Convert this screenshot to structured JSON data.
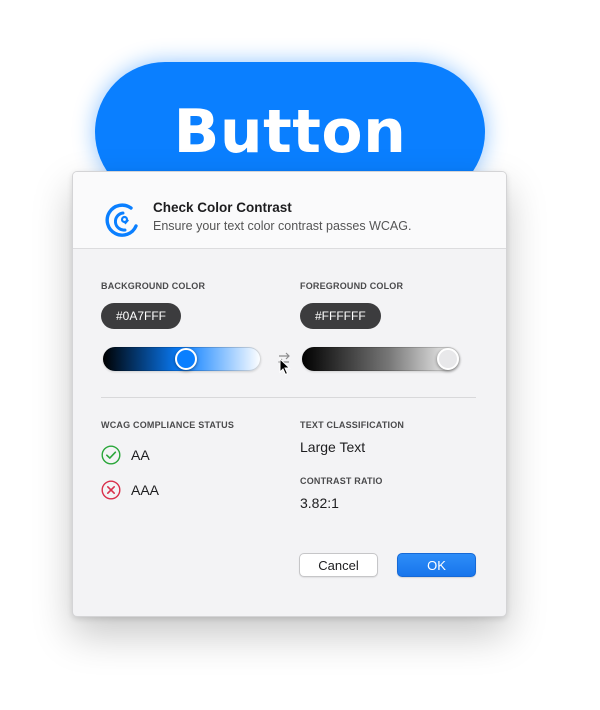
{
  "preview": {
    "label": "Button",
    "background": "#0A7FFF",
    "text_color": "#FFFFFF"
  },
  "dialog": {
    "title": "Check Color Contrast",
    "subtitle": "Ensure your text color contrast passes WCAG.",
    "icon": "contrast-checker-icon"
  },
  "background_color": {
    "label": "BACKGROUND COLOR",
    "hex": "#0A7FFF",
    "slider_value": 0.53
  },
  "foreground_color": {
    "label": "FOREGROUND COLOR",
    "hex": "#FFFFFF",
    "slider_value": 1.0
  },
  "swap_icon": "swap-arrows-icon",
  "compliance": {
    "label": "WCAG COMPLIANCE STATUS",
    "items": [
      {
        "level": "AA",
        "status": "pass",
        "icon": "check-circle-icon",
        "color": "#2aa63a"
      },
      {
        "level": "AAA",
        "status": "fail",
        "icon": "x-circle-icon",
        "color": "#d9304b"
      }
    ]
  },
  "classification": {
    "label": "TEXT CLASSIFICATION",
    "value": "Large Text"
  },
  "contrast": {
    "label": "CONTRAST RATIO",
    "value": "3.82:1"
  },
  "buttons": {
    "cancel": "Cancel",
    "ok": "OK"
  },
  "colors": {
    "accent": "#0A7FFF",
    "pass": "#2aa63a",
    "fail": "#d9304b"
  }
}
